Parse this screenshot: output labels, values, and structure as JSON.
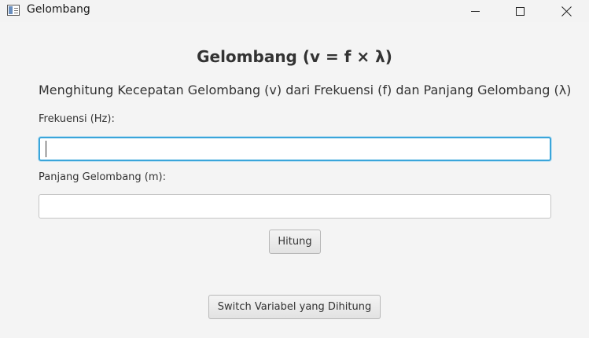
{
  "window": {
    "title": "Gelombang"
  },
  "main": {
    "heading": "Gelombang (v = f × λ)",
    "subtitle": "Menghitung Kecepatan Gelombang (v) dari Frekuensi (f) dan Panjang Gelombang (λ)",
    "frequency_label": "Frekuensi (Hz):",
    "frequency_value": "",
    "wavelength_label": "Panjang Gelombang (m):",
    "wavelength_value": "",
    "calculate_button": "Hitung",
    "switch_button": "Switch Variabel yang Dihitung"
  },
  "colors": {
    "focus_border": "#3aa5da",
    "background": "#f4f4f4"
  },
  "icons": {
    "app": "app-window-icon",
    "minimize": "minimize-icon",
    "maximize": "maximize-icon",
    "close": "close-icon"
  }
}
